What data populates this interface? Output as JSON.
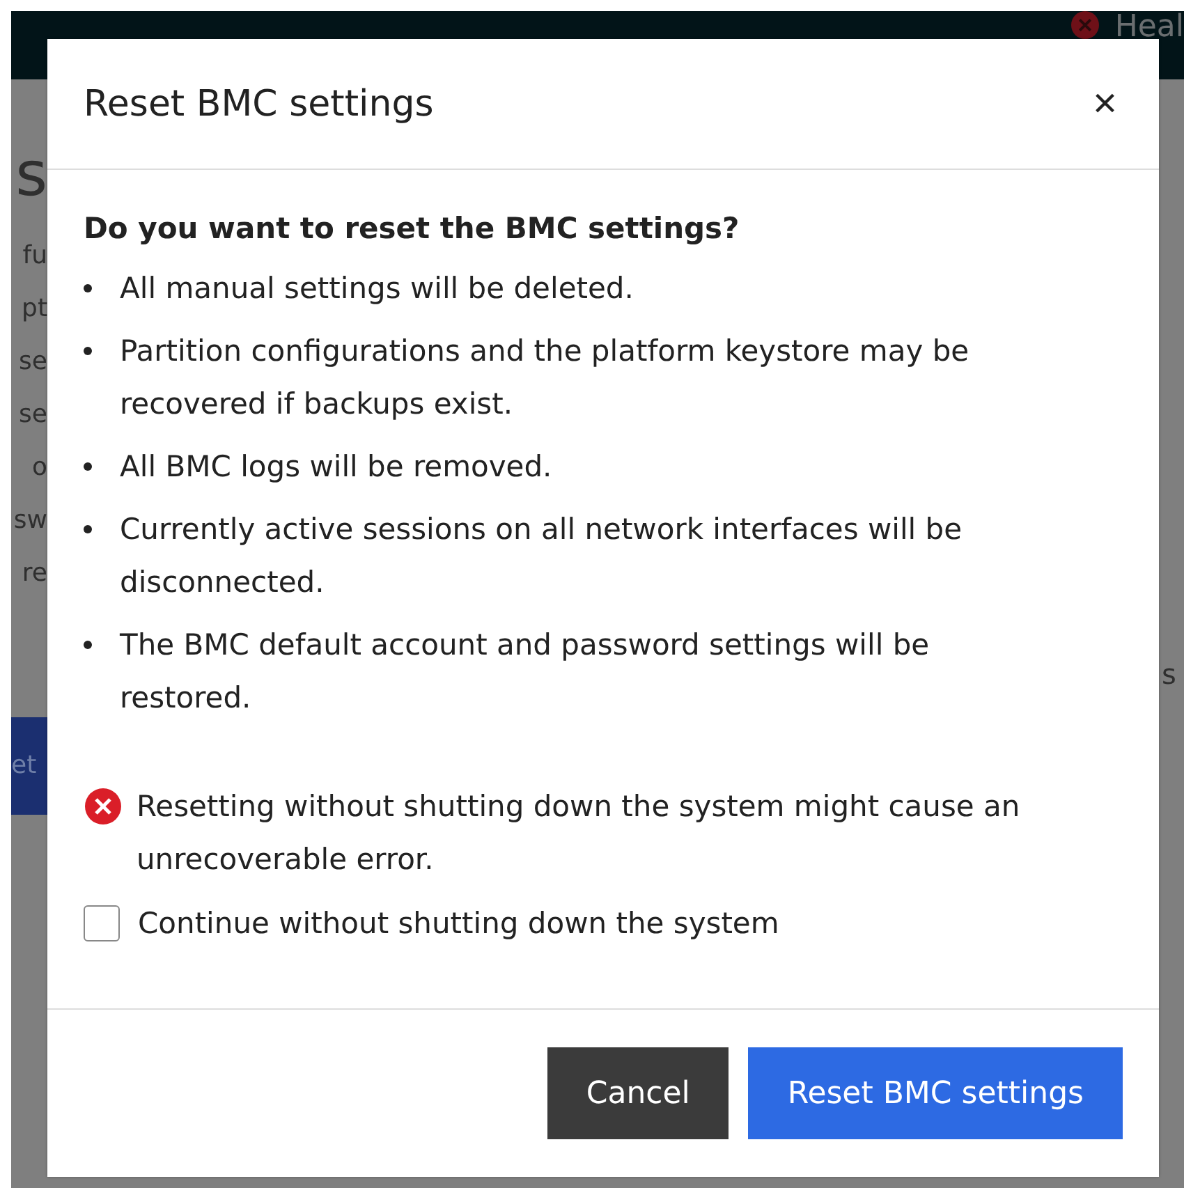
{
  "background": {
    "header_status": "Heal",
    "fragments_left": [
      {
        "text": "s",
        "kind": "heading"
      },
      {
        "text": "fu",
        "kind": "text"
      },
      {
        "text": "pt",
        "kind": "text"
      },
      {
        "text": "se",
        "kind": "text"
      },
      {
        "text": "se",
        "kind": "text"
      },
      {
        "text": "o",
        "kind": "text"
      },
      {
        "text": "sw",
        "kind": "text"
      },
      {
        "text": "re",
        "kind": "text"
      },
      {
        "text": "et",
        "kind": "button"
      }
    ],
    "fragment_right": "s"
  },
  "dialog": {
    "title": "Reset BMC settings",
    "close": "×",
    "question": "Do you want to reset the BMC settings?",
    "bullets": [
      "All manual settings will be deleted.",
      "Partition configurations and the platform keystore may be recovered if backups exist.",
      "All BMC logs will be removed.",
      "Currently active sessions on all network interfaces will be disconnected.",
      "The BMC default account and password settings will be restored."
    ],
    "warning": "Resetting without shutting down the system might cause an unrecoverable error.",
    "checkbox": {
      "label": "Continue without shutting down the system",
      "checked": false
    },
    "buttons": [
      {
        "label": "Cancel",
        "kind": "secondary"
      },
      {
        "label": "Reset BMC settings",
        "kind": "primary"
      }
    ]
  }
}
